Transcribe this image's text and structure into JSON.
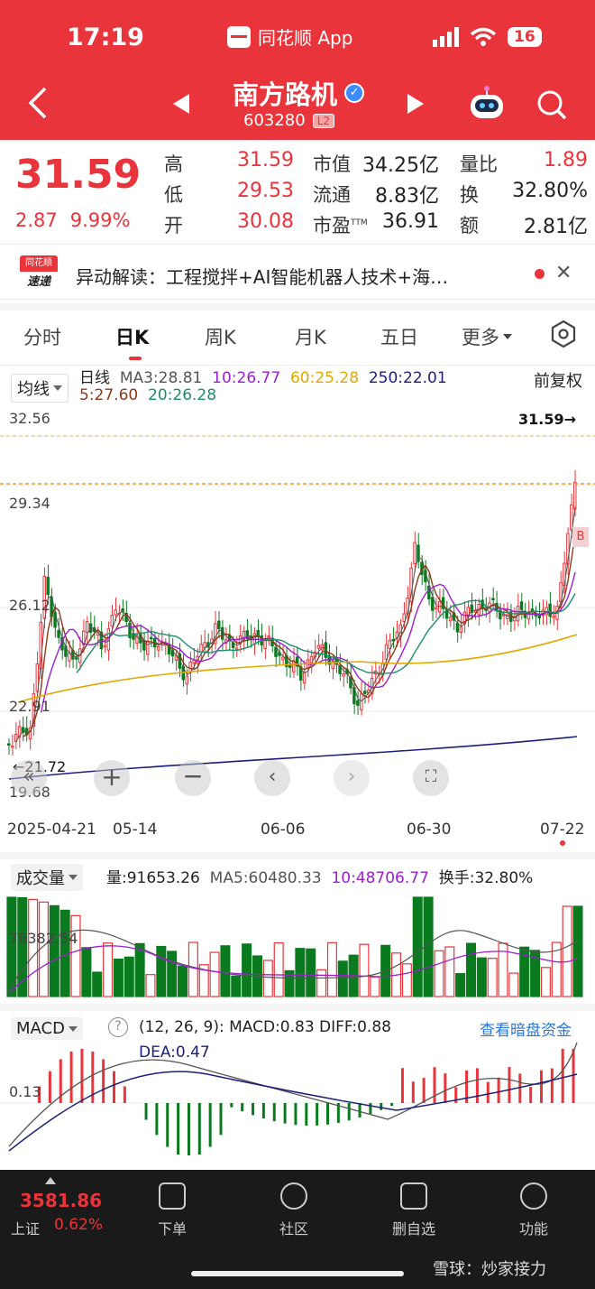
{
  "status_bar": {
    "time": "17:19",
    "app_label": "同花顺 App",
    "battery": "16"
  },
  "header": {
    "stock_name": "南方路机",
    "stock_code": "603280",
    "level_badge": "L2"
  },
  "quote": {
    "price": "31.59",
    "change": "2.87",
    "change_pct": "9.99%",
    "rows": [
      [
        {
          "label": "高",
          "value": "31.59"
        },
        {
          "label": "市值",
          "value": "34.25亿"
        },
        {
          "label": "量比",
          "value": "1.89"
        }
      ],
      [
        {
          "label": "低",
          "value": "29.53"
        },
        {
          "label": "流通",
          "value": "8.83亿"
        },
        {
          "label": "换",
          "value": "32.80%"
        }
      ],
      [
        {
          "label": "开",
          "value": "30.08"
        },
        {
          "label": "市盈",
          "value": "36.91"
        },
        {
          "label": "额",
          "value": "2.81亿"
        }
      ]
    ],
    "pe_superscript": "TTM"
  },
  "news": {
    "logo_top": "同花顺",
    "logo_bottom": "速递",
    "text": "异动解读：工程搅拌+AI智能机器人技术+海…"
  },
  "tabs": [
    "分时",
    "日K",
    "周K",
    "月K",
    "五日",
    "更多"
  ],
  "kline": {
    "selector": "均线",
    "right_label": "前复权",
    "ma_row1": [
      {
        "text": "日线",
        "color": "#222"
      },
      {
        "text": "MA3:28.81",
        "color": "#555"
      },
      {
        "text": "10:26.77",
        "color": "#9b1fd1"
      },
      {
        "text": "60:25.28",
        "color": "#e0a800"
      },
      {
        "text": "250:22.01",
        "color": "#1b1f7a"
      }
    ],
    "ma_row2": [
      {
        "text": "5:27.60",
        "color": "#8b3a1a"
      },
      {
        "text": "20:26.28",
        "color": "#1a8f6a"
      }
    ],
    "y_labels": [
      "32.56",
      "29.34",
      "26.12",
      "22.91",
      "19.68"
    ],
    "last_price_label": "31.59→",
    "low_label": "←21.72",
    "x_labels": [
      "2025-04-21",
      "05-14",
      "06-06",
      "06-30",
      "07-22"
    ],
    "marker_b": "B"
  },
  "volume": {
    "selector": "成交量",
    "stats": [
      {
        "text": "量:91653.26",
        "color": "#222"
      },
      {
        "text": "MA5:60480.33",
        "color": "#555"
      },
      {
        "text": "10:48706.77",
        "color": "#9b1fd1"
      },
      {
        "text": "换手:32.80%",
        "color": "#222"
      }
    ],
    "y_label": "76382.54"
  },
  "macd": {
    "selector": "MACD",
    "params": "(12, 26, 9):",
    "macd": "MACD:0.83",
    "diff": "DIFF:0.88",
    "dea": "DEA:0.47",
    "link": "查看暗盘资金",
    "y_label": "0.13"
  },
  "bottom_nav": {
    "index_value": "3581.86",
    "index_name": "上证",
    "index_change": "0.62%",
    "items": [
      "下单",
      "社区",
      "删自选",
      "功能"
    ]
  },
  "watermark": "雪球：炒家接力",
  "colors": {
    "up": "#e8343a",
    "down": "#0a7a1f",
    "header_bg": "#e8343a"
  }
}
